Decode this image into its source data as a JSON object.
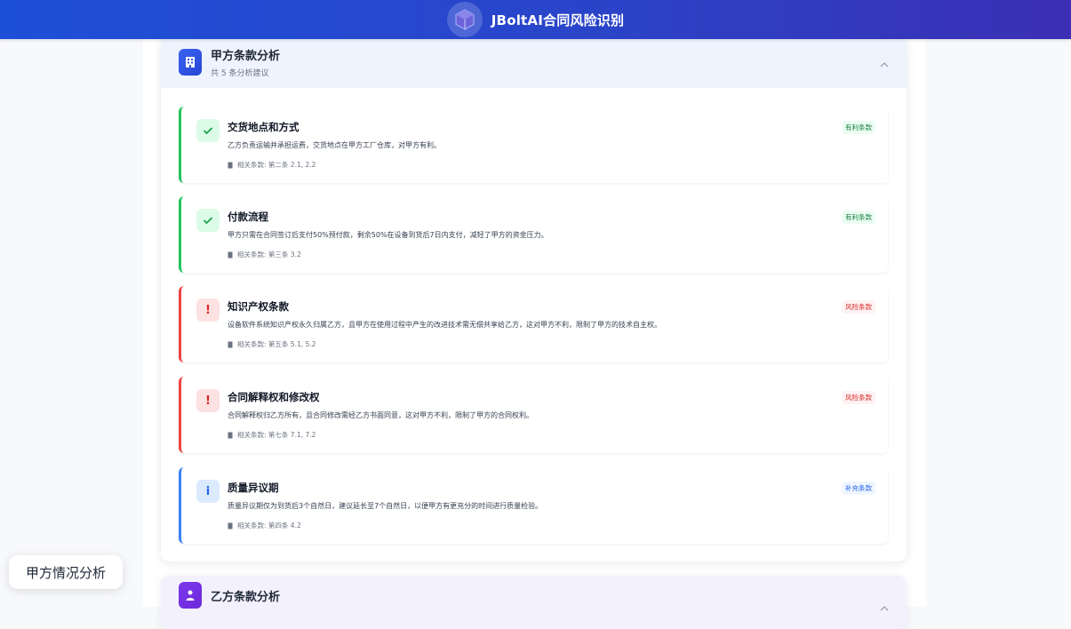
{
  "header": {
    "title": "JBoltAI合同风险识别"
  },
  "section_a": {
    "title": "甲方条款分析",
    "subtitle": "共 5 条分析建议",
    "icon": "building-icon",
    "items": [
      {
        "title": "交货地点和方式",
        "desc": "乙方负责运输并承担运费，交货地点在甲方工厂仓库，对甲方有利。",
        "ref": "相关条款: 第二条 2.1, 2.2",
        "badge": "有利条款",
        "kind": "favorable",
        "icon": "check-icon"
      },
      {
        "title": "付款流程",
        "desc": "甲方只需在合同签订后支付50%预付款，剩余50%在设备到货后7日内支付，减轻了甲方的资金压力。",
        "ref": "相关条款: 第三条 3.2",
        "badge": "有利条款",
        "kind": "favorable",
        "icon": "check-icon"
      },
      {
        "title": "知识产权条款",
        "desc": "设备软件系统知识产权永久归属乙方，且甲方在使用过程中产生的改进技术需无偿共享给乙方，这对甲方不利，限制了甲方的技术自主权。",
        "ref": "相关条款: 第五条 5.1, 5.2",
        "badge": "风险条款",
        "kind": "risk",
        "icon": "exclamation-icon"
      },
      {
        "title": "合同解释权和修改权",
        "desc": "合同解释权归乙方所有，且合同修改需经乙方书面同意，这对甲方不利，限制了甲方的合同权利。",
        "ref": "相关条款: 第七条 7.1, 7.2",
        "badge": "风险条款",
        "kind": "risk",
        "icon": "exclamation-icon"
      },
      {
        "title": "质量异议期",
        "desc": "质量异议期仅为到货后3个自然日，建议延长至7个自然日，以便甲方有更充分的时间进行质量检验。",
        "ref": "相关条款: 第四条 4.2",
        "badge": "补充条款",
        "kind": "supplement",
        "icon": "info-icon"
      }
    ]
  },
  "section_b": {
    "title": "乙方条款分析",
    "icon": "person-icon"
  },
  "floating_tag": {
    "label": "甲方情况分析"
  },
  "colors": {
    "header_start": "#1e4fd8",
    "header_end": "#3b2fb4",
    "favorable": "#22c55e",
    "risk": "#ef4444",
    "supplement": "#3b82f6"
  }
}
